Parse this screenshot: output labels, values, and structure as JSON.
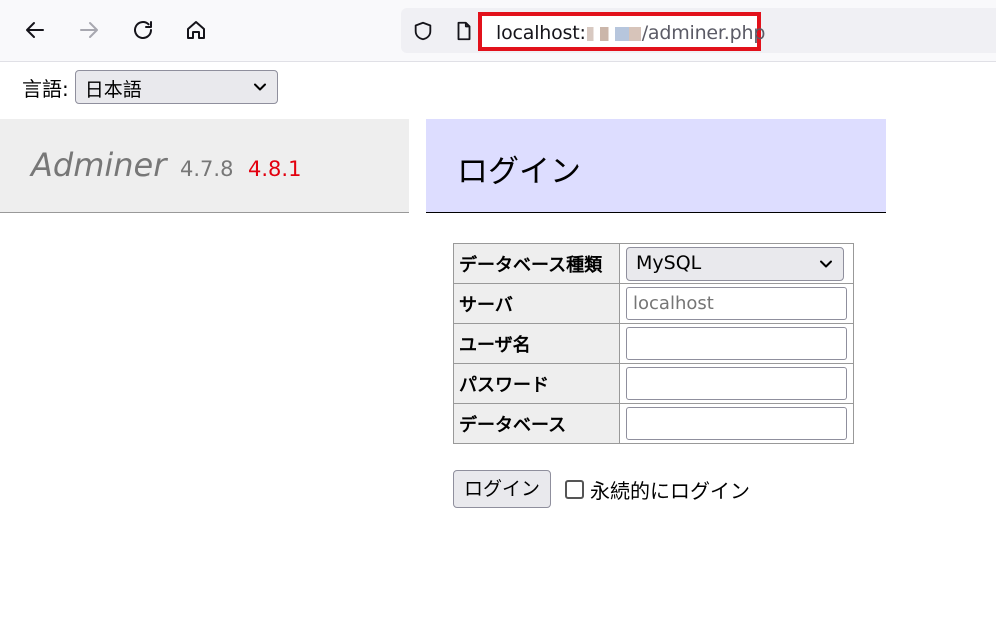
{
  "browser": {
    "url_host": "localhost:",
    "url_path": "/adminer.php"
  },
  "language": {
    "label": "言語:",
    "selected": "日本語"
  },
  "brand": {
    "name": "Adminer",
    "version": "4.7.8",
    "new_version": "4.8.1"
  },
  "page": {
    "title": "ログイン"
  },
  "form": {
    "rows": [
      {
        "label": "データベース種類",
        "value": "MySQL"
      },
      {
        "label": "サーバ",
        "placeholder": "localhost"
      },
      {
        "label": "ユーザ名",
        "value": ""
      },
      {
        "label": "パスワード",
        "value": ""
      },
      {
        "label": "データベース",
        "value": ""
      }
    ],
    "submit_label": "ログイン",
    "permanent_label": "永続的にログイン"
  },
  "colors": {
    "accent_header": "#ddddff",
    "highlight_box": "#e2111b",
    "new_version": "#e3000f"
  },
  "icons": [
    "back-arrow-icon",
    "forward-arrow-icon",
    "reload-icon",
    "home-icon",
    "shield-icon",
    "page-icon",
    "chevron-down-icon"
  ]
}
